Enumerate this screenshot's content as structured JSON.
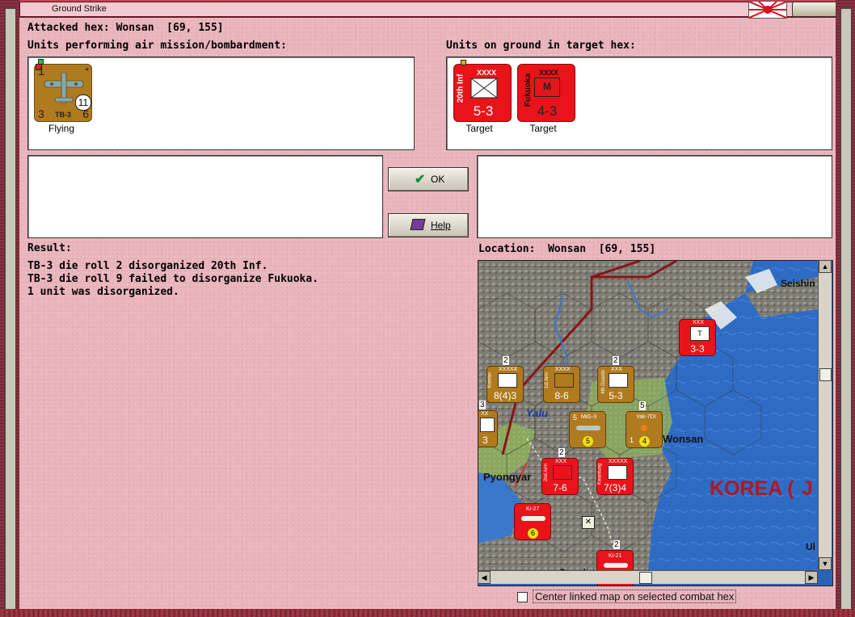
{
  "window": {
    "title": "Ground Strike"
  },
  "header": {
    "attacked_hex": "Attacked hex: Wonsan  [69, 155]"
  },
  "air_panel": {
    "label": "Units performing air mission/bombardment:",
    "units": [
      {
        "name": "TB-3",
        "top_left": "1",
        "top_right": "*",
        "bottom_left": "3",
        "bottom_right": "6",
        "badge": "11",
        "caption": "Flying"
      }
    ]
  },
  "ground_panel": {
    "label": "Units on ground in target hex:",
    "units": [
      {
        "name": "20th Inf",
        "size": "XXXX",
        "strength": "5-3",
        "caption": "Target",
        "symbol": "infantry-cross-icon"
      },
      {
        "name": "Fukuoka",
        "size": "XXXX",
        "strength": "4-3",
        "caption": "Target",
        "symbol": "mech-icon",
        "symbol_text": "M"
      }
    ]
  },
  "buttons": {
    "ok": "OK",
    "help": "Help"
  },
  "result": {
    "label": "Result:",
    "lines": [
      "TB-3 die roll 2 disorganized 20th Inf.",
      "TB-3 die roll 9 failed to disorganize Fukuoka.",
      "1 unit was disorganized."
    ]
  },
  "location": {
    "label": "Location:  Wonsan  [69, 155]"
  },
  "map": {
    "places": {
      "seishin": "Seishin",
      "yalu": "Yalu",
      "wonsan": "Wonsan",
      "pyongyang": "Pyongyar",
      "korea": "KOREA (",
      "korea_tail": "J",
      "ul": "Ul",
      "seoul": "Seoul"
    },
    "units": [
      {
        "id": "u1",
        "size": "XXXXX",
        "value": "8(4)3",
        "stack": "2",
        "label": "Korean",
        "color": "brown"
      },
      {
        "id": "u2",
        "size": "XXXX",
        "value": "8-6",
        "label": "1st Arm",
        "color": "brown"
      },
      {
        "id": "u3",
        "size": "XXX",
        "value": "5-3",
        "stack": "2",
        "label": "4th Guards",
        "color": "brown"
      },
      {
        "id": "u4",
        "size": "XXX",
        "value": "3-3",
        "label": "T",
        "color": "red"
      },
      {
        "id": "u5",
        "name": "MiG-3",
        "value": "5",
        "left": "5",
        "color": "brown"
      },
      {
        "id": "u6",
        "name": "Yak-7DI",
        "value": "4",
        "left": "1",
        "stack": "5",
        "color": "brown"
      },
      {
        "id": "u7",
        "size": "XXX",
        "value": "7-6",
        "stack": "2",
        "label": "2nd Arm",
        "color": "red"
      },
      {
        "id": "u8",
        "size": "XXXXX",
        "value": "7(3)4",
        "label": "Kwantung",
        "color": "red"
      },
      {
        "id": "u9",
        "name": "Ki-27",
        "value": "6",
        "color": "red"
      },
      {
        "id": "u10",
        "size": "XX",
        "value": "3",
        "stack": "3",
        "color": "brown"
      },
      {
        "id": "u11",
        "name": "Ki-21",
        "stack": "2",
        "color": "red"
      }
    ]
  },
  "footer": {
    "checkbox_label": "Center linked map on selected combat hex"
  },
  "colors": {
    "counter_brown": "#b07a1e",
    "counter_red": "#e8141a",
    "panel_bg": "#e9b4bc",
    "frame": "#7a2430"
  }
}
